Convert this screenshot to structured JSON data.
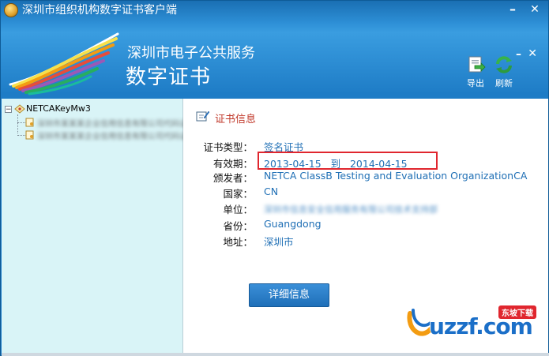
{
  "window": {
    "title": "深圳市组织机构数字证书客户端",
    "minimize_glyph": "–",
    "close_glyph": "✕"
  },
  "header": {
    "brand_line1": "深圳市电子公共服务",
    "brand_line2": "数字证书",
    "sub_minimize": "–",
    "sub_close": "✕",
    "toolbar": {
      "export_label": "导出",
      "refresh_label": "刷新"
    }
  },
  "tree": {
    "root_label": "NETCAKeyMw3",
    "expander_glyph": "−",
    "children": [
      {
        "label": "深圳市某某某企业信用信息有限公司代码证书"
      },
      {
        "label": "深圳市某某某企业信用信息有限公司代码证书"
      }
    ]
  },
  "cert": {
    "section_title": "证书信息",
    "fields": {
      "type_label": "证书类型：",
      "type_value": "签名证书",
      "validity_label": "有效期：",
      "validity_value": "2013-04-15   到   2014-04-15",
      "issuer_label": "颁发者：",
      "issuer_value": "NETCA ClassB Testing and Evaluation OrganizationCA",
      "country_label": "国家：",
      "country_value": "CN",
      "unit_label": "单位：",
      "unit_value": "深圳市信息安全信用服务有限公司技术支持部",
      "province_label": "省份：",
      "province_value": "Guangdong",
      "address_label": "地址：",
      "address_value": "深圳市"
    },
    "detail_button": "详细信息"
  },
  "watermark": {
    "text": "uzzf.com",
    "tag": "东坡下载"
  },
  "colors": {
    "header_blue": "#2d8fd6",
    "left_pane": "#d9f4f7",
    "value_blue": "#1f6fb5",
    "title_red": "#c0392b",
    "highlight_red": "#e0262e"
  }
}
